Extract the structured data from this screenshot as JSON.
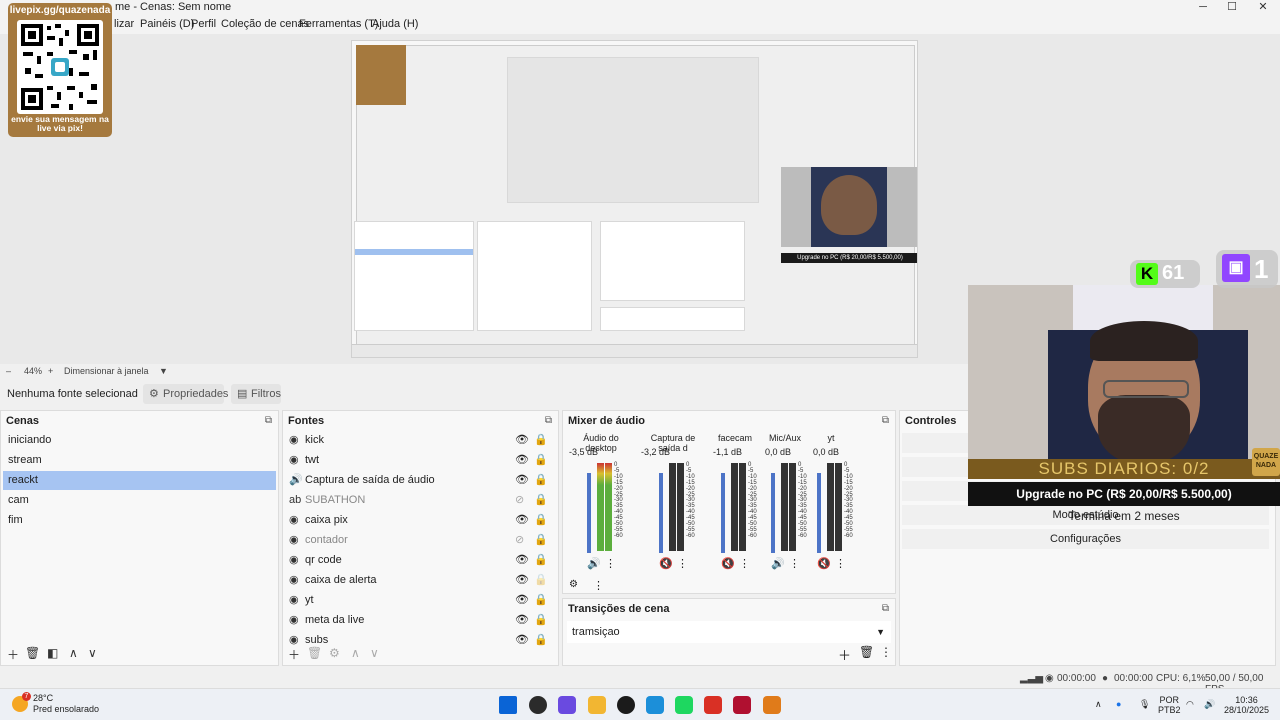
{
  "window": {
    "title": "me - Cenas: Sem nome",
    "minimize": "─",
    "maximize": "☐",
    "close": "✕"
  },
  "menu": {
    "items": [
      "lizar",
      "Painéis (D)",
      "Perfil",
      "Coleção de cenas",
      "Ferramentas (T)",
      "Ajuda (H)"
    ]
  },
  "overlay": {
    "qr_top": "livepix.gg/quazenada",
    "qr_bottom": "envie sua mensagem na live via pix!",
    "kick_count": "61",
    "twitch_count": "1",
    "subs_banner": "SUBS DIARIOS: 0/2",
    "upgrade": "Upgrade no PC (R$ 20,00/R$ 5.500,00)",
    "term": "Termina em 2 meses",
    "logo": "QUAZE NADA"
  },
  "zoom": {
    "minus": "–",
    "value": "44%",
    "plus": "+",
    "fit": "Dimensionar à janela",
    "arrow": "▼"
  },
  "toolbar": {
    "no_source": "Nenhuma fonte selecionad",
    "properties": "Propriedades",
    "filters": "Filtros"
  },
  "scenes": {
    "title": "Cenas",
    "items": [
      "iniciando",
      "stream",
      "reackt",
      "cam",
      "fim"
    ],
    "active_index": 2
  },
  "sources": {
    "title": "Fontes",
    "items": [
      {
        "name": "kick",
        "icon": "globe-icon",
        "visible": true,
        "locked": true
      },
      {
        "name": "twt",
        "icon": "globe-icon",
        "visible": true,
        "locked": true
      },
      {
        "name": "Captura de saída de áudio",
        "icon": "speaker-icon",
        "visible": true,
        "locked": true
      },
      {
        "name": "SUBATHON",
        "icon": "text-icon",
        "visible": false,
        "locked": true
      },
      {
        "name": "caixa pix",
        "icon": "globe-icon",
        "visible": true,
        "locked": true
      },
      {
        "name": "contador",
        "icon": "globe-icon",
        "visible": false,
        "locked": true
      },
      {
        "name": "qr code",
        "icon": "globe-icon",
        "visible": true,
        "locked": true
      },
      {
        "name": "caixa de alerta",
        "icon": "globe-icon",
        "visible": true,
        "locked": false
      },
      {
        "name": "yt",
        "icon": "globe-icon",
        "visible": true,
        "locked": true
      },
      {
        "name": "meta da live",
        "icon": "globe-icon",
        "visible": true,
        "locked": true
      },
      {
        "name": "subs",
        "icon": "globe-icon",
        "visible": true,
        "locked": true
      }
    ]
  },
  "mixer": {
    "title": "Mixer de áudio",
    "scale": [
      "0",
      "-5",
      "-10",
      "-15",
      "-20",
      "-25",
      "-30",
      "-35",
      "-40",
      "-45",
      "-50",
      "-55",
      "-60"
    ],
    "channels": [
      {
        "name": "Áudio do desktop",
        "db": "-3,5 dB",
        "muted": false,
        "level": 0.9
      },
      {
        "name": "Captura de saída d",
        "db": "-3,2 dB",
        "muted": true,
        "level": 0.0
      },
      {
        "name": "facecam",
        "db": "-1,1 dB",
        "muted": true,
        "level": 0.0
      },
      {
        "name": "Mic/Aux",
        "db": "0,0 dB",
        "muted": false,
        "level": 0.0
      },
      {
        "name": "yt",
        "db": "0,0 dB",
        "muted": true,
        "level": 0.0
      }
    ]
  },
  "transitions": {
    "title": "Transições de cena",
    "selected": "tramsiçao"
  },
  "controls": {
    "title": "Controles",
    "buttons": [
      "",
      "",
      "",
      "Modo estúdio",
      "Configurações"
    ]
  },
  "status": {
    "rec_time": "00:00:00",
    "stream_time": "00:00:00",
    "cpu": "CPU: 6,1%",
    "fps": "50,00 / 50,00 FPS"
  },
  "taskbar": {
    "temp": "28°C",
    "weather": "Pred ensolarado",
    "badge": "7",
    "lang": "POR",
    "layout": "PTB2",
    "time": "10:36",
    "date": "28/10/2025",
    "colors": [
      "#0a64d6",
      "#2b2b2b",
      "#6a4ae0",
      "#f2b632",
      "#1b1b1b",
      "#1c8fd9",
      "#1ed760",
      "#d93025",
      "#b01030",
      "#e07b1a"
    ]
  }
}
